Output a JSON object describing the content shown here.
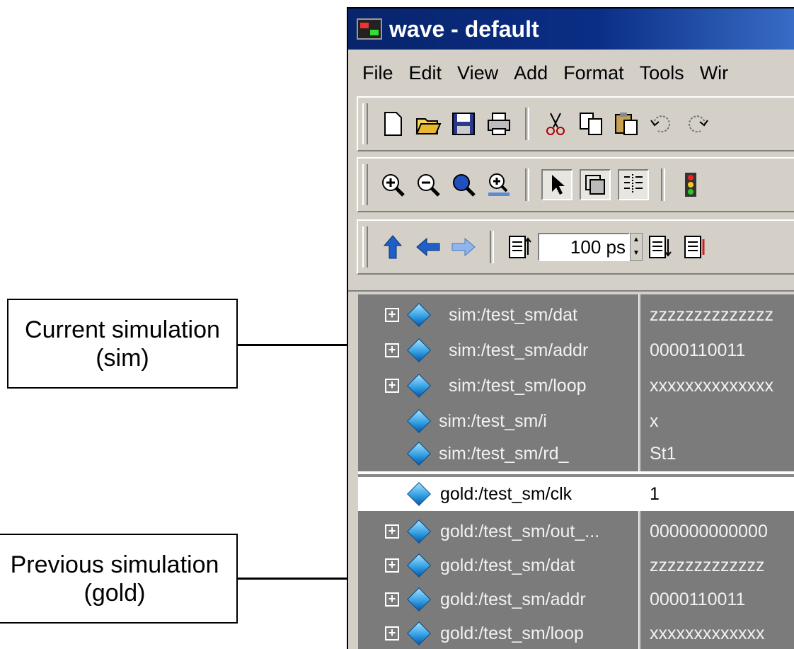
{
  "window": {
    "title": "wave - default",
    "title_bar_color": "#08246b",
    "menu": [
      "File",
      "Edit",
      "View",
      "Add",
      "Format",
      "Tools",
      "Wir"
    ]
  },
  "toolbars": {
    "file": [
      "new-file-icon",
      "open-folder-icon",
      "save-icon",
      "print-icon",
      "cut-icon",
      "copy-icon",
      "paste-icon",
      "undo-icon",
      "redo-icon"
    ],
    "zoom": [
      "zoom-in-icon",
      "zoom-out-icon",
      "zoom-full-icon",
      "zoom-cursor-icon",
      "select-arrow-icon",
      "zoom-mode-icon",
      "edit-mode-icon",
      "traffic-light-icon"
    ],
    "cursor": [
      "up-arrow-icon",
      "left-arrow-icon",
      "right-arrow-icon",
      "run-icon",
      "step-icon",
      "step-over-icon"
    ],
    "time_value": "100 ps"
  },
  "signals": {
    "sim": [
      {
        "name": "sim:/test_sm/dat",
        "value": "zzzzzzzzzzzzzz",
        "expandable": true
      },
      {
        "name": "sim:/test_sm/addr",
        "value": "0000110011",
        "expandable": true
      },
      {
        "name": "sim:/test_sm/loop",
        "value": "xxxxxxxxxxxxxx",
        "expandable": true
      },
      {
        "name": "sim:/test_sm/i",
        "value": "x",
        "expandable": false
      },
      {
        "name": "sim:/test_sm/rd_",
        "value": "St1",
        "expandable": false
      }
    ],
    "gold": [
      {
        "name": "gold:/test_sm/clk",
        "value": "1",
        "expandable": false,
        "selected": true
      },
      {
        "name": "gold:/test_sm/out_...",
        "value": "000000000000",
        "expandable": true
      },
      {
        "name": "gold:/test_sm/dat",
        "value": "zzzzzzzzzzzzz",
        "expandable": true
      },
      {
        "name": "gold:/test_sm/addr",
        "value": "0000110011",
        "expandable": true
      },
      {
        "name": "gold:/test_sm/loop",
        "value": "xxxxxxxxxxxxx",
        "expandable": true
      }
    ]
  },
  "annotations": {
    "sim": [
      "Current simulation",
      "(sim)"
    ],
    "gold": [
      "Previous simulation",
      "(gold)"
    ]
  }
}
